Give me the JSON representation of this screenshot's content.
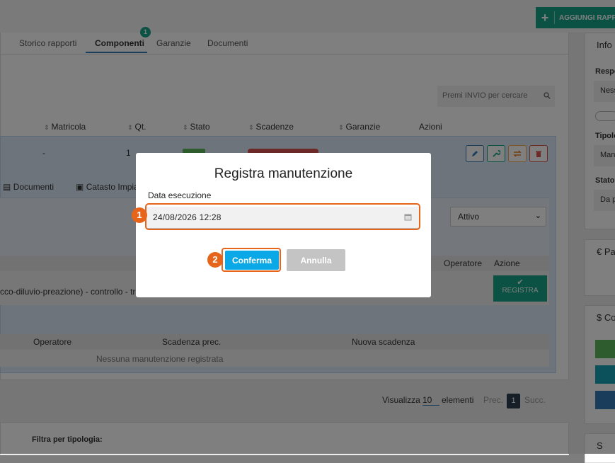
{
  "toolbar": {
    "add_report_label": "AGGIUNGI RAPP"
  },
  "tabs": [
    {
      "label": "Storico rapporti"
    },
    {
      "label": "Componenti",
      "badge": "1"
    },
    {
      "label": "Garanzie"
    },
    {
      "label": "Documenti"
    }
  ],
  "search": {
    "placeholder": "Premi INVIO per cercare"
  },
  "table": {
    "columns": [
      "Matricola",
      "Qt.",
      "Stato",
      "Scadenze",
      "Garanzie",
      "Azioni"
    ],
    "row": {
      "matricola": "-",
      "qt": "1"
    }
  },
  "detail": {
    "subtabs": [
      "Documenti",
      "Catasto Impia"
    ],
    "status_select": "Attivo",
    "plan_columns": [
      "Operatore",
      "Azione"
    ],
    "plan_row_text": "cco-diluvio-preazione) - controllo - tri",
    "register_label": "REGISTRA",
    "history_columns": [
      "Operatore",
      "Scadenza prec.",
      "Nuova scadenza"
    ],
    "history_empty": "Nessuna manutenzione registrata"
  },
  "pagination": {
    "show_label": "Visualizza",
    "page_size": "10",
    "elements_label": "elementi",
    "prev": "Prec.",
    "current": "1",
    "next": "Succ."
  },
  "filter": {
    "label": "Filtra per tipologia:"
  },
  "side": {
    "info_title": "Info",
    "resp_label": "Respo",
    "resp_value": "Ness",
    "tipo_label": "Tipolo",
    "tipo_value": "Man",
    "stato_label": "Stato",
    "stato_value": "Da p",
    "pa_title": "€ Pa",
    "co_title": "$ Co",
    "s_title": "S"
  },
  "modal": {
    "title": "Registra manutenzione",
    "field_label": "Data esecuzione",
    "date_value": "24/08/2026 12:28",
    "confirm_label": "Conferma",
    "cancel_label": "Annulla"
  },
  "markers": [
    "1",
    "2"
  ],
  "colors": {
    "teal": "#17a589",
    "accent_blue": "#0aa8e6",
    "marker_orange": "#e6651b",
    "danger": "#d9534f"
  }
}
